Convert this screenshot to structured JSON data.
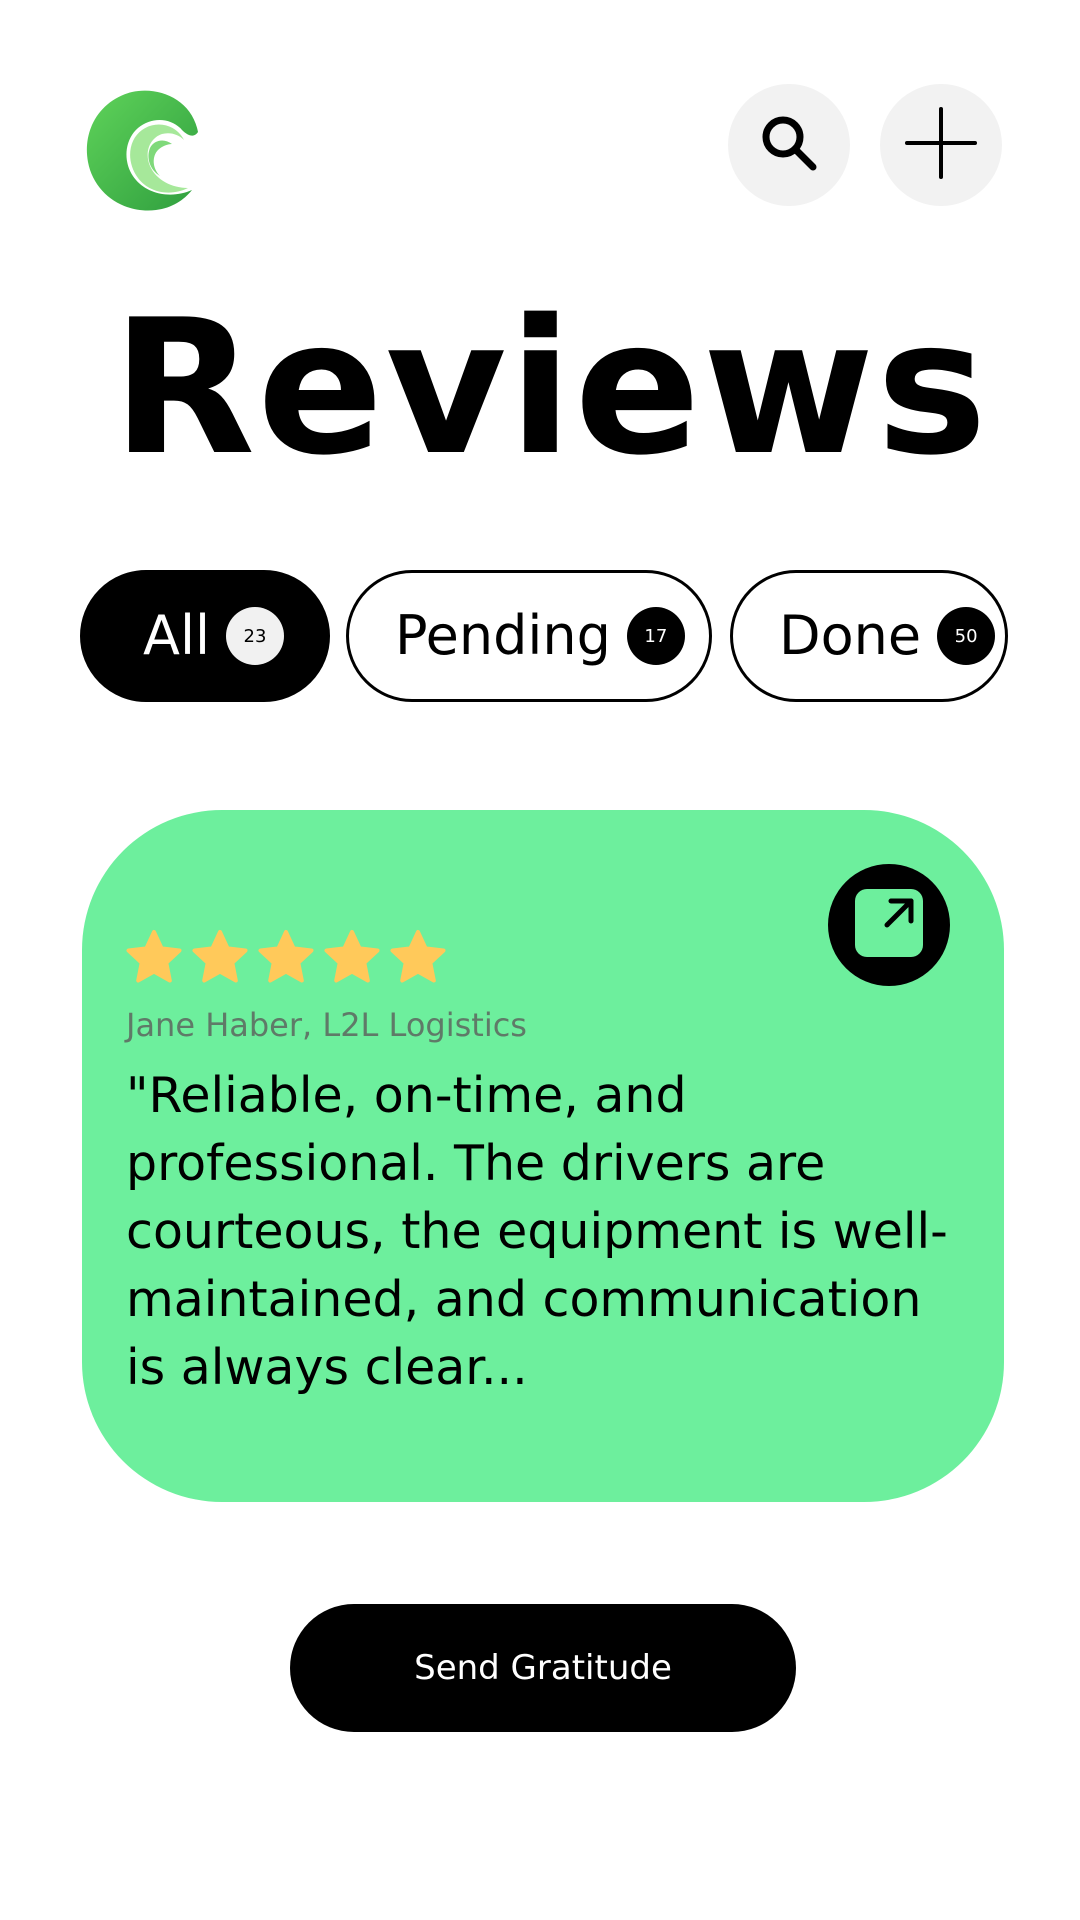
{
  "header": {
    "logo_icon": "wave-logo-icon",
    "search_icon": "search-icon",
    "add_icon": "plus-icon"
  },
  "page": {
    "title": "Reviews"
  },
  "filters": [
    {
      "label": "All",
      "count": "23",
      "active": true
    },
    {
      "label": "Pending",
      "count": "17",
      "active": false
    },
    {
      "label": "Done",
      "count": "50",
      "active": false
    }
  ],
  "review": {
    "rating": 5,
    "rating_max": 5,
    "reviewer": "Jane Haber, L2L Logistics",
    "text": "\"Reliable, on-time, and professional. The drivers are courteous, the equipment is well-maintained, and communication is always clear...",
    "open_icon": "external-link-icon"
  },
  "actions": {
    "send_label": "Send Gratitude"
  },
  "colors": {
    "card_bg": "#6def9d",
    "star": "#ffc95a",
    "logo_green": "#3fbf4f",
    "icon_button_bg": "#f2f2f2",
    "primary": "#000000"
  }
}
